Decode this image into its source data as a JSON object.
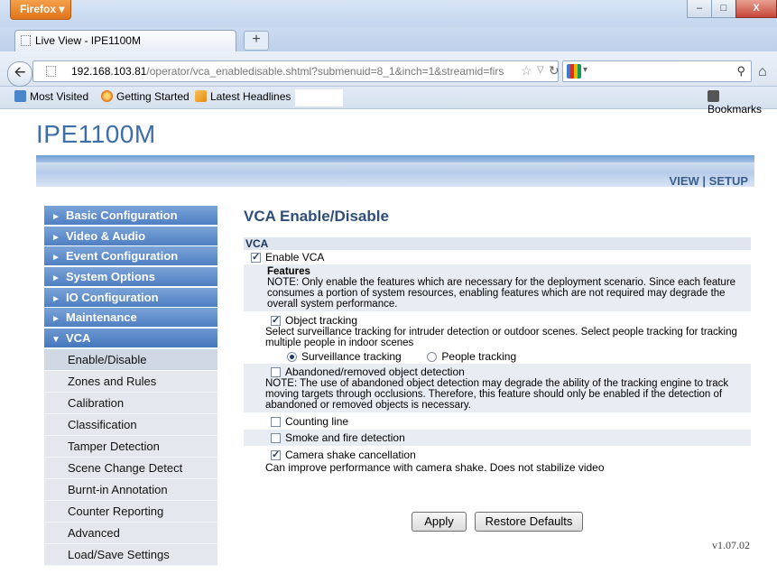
{
  "browser": {
    "app_button": "Firefox ▾",
    "window_buttons": [
      "–",
      "□",
      "X"
    ],
    "tab_title": "Live View - IPE1100M",
    "new_tab": "+",
    "url_host": "192.168.103.81",
    "url_path": "/operator/vca_enabledisable.shtml?submenuid=8_1&inch=1&streamid=firs",
    "bookmarks": [
      "Most Visited",
      "Getting Started",
      "Latest Headlines"
    ],
    "bookmarks_menu": "Bookmarks"
  },
  "page": {
    "title": "IPE1100M",
    "nav": {
      "view": "VIEW",
      "sep": " | ",
      "setup": "SETUP"
    }
  },
  "sidebar": {
    "menu": [
      "Basic Configuration",
      "Video & Audio",
      "Event Configuration",
      "System Options",
      "IO Configuration",
      "Maintenance",
      "VCA"
    ],
    "submenu": [
      "Enable/Disable",
      "Zones and Rules",
      "Calibration",
      "Classification",
      "Tamper Detection",
      "Scene Change Detect",
      "Burnt-in Annotation",
      "Counter Reporting",
      "Advanced",
      "Load/Save Settings"
    ]
  },
  "content": {
    "title": "VCA Enable/Disable",
    "section_header": "VCA",
    "enable_vca": {
      "label": "Enable VCA",
      "checked": true
    },
    "features_label": "Features",
    "features_note": "NOTE: Only enable the features which are necessary for the deployment scenario. Since each feature consumes a portion of system resources, enabling features which are not required may degrade the overall system performance.",
    "object_tracking": {
      "label": "Object tracking",
      "checked": true
    },
    "object_tracking_desc": "Select surveillance tracking for intruder detection or outdoor scenes. Select people tracking for tracking multiple people in indoor scenes",
    "tracking_options": {
      "surveillance": "Surveillance tracking",
      "people": "People tracking",
      "selected": "surveillance"
    },
    "abandoned": {
      "label": "Abandoned/removed object detection",
      "checked": false
    },
    "abandoned_note": "NOTE: The use of abandoned object detection may degrade the ability of the tracking engine to track moving targets through occlusions. Therefore, this feature should only be enabled if the detection of abandoned or removed objects is necessary.",
    "counting_line": {
      "label": "Counting line",
      "checked": false
    },
    "smoke_fire": {
      "label": "Smoke and fire detection",
      "checked": false
    },
    "camera_shake": {
      "label": "Camera shake cancellation",
      "checked": true
    },
    "camera_shake_desc": "Can improve performance with camera shake. Does not stabilize video",
    "apply_button": "Apply",
    "restore_button": "Restore Defaults",
    "version": "v1.07.02"
  }
}
